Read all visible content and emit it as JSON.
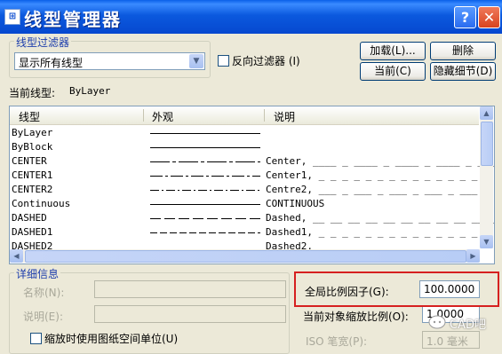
{
  "window": {
    "title": "线型管理器",
    "help_label": "?",
    "close_label": "✕"
  },
  "filter": {
    "group_label": "线型过滤器",
    "selected": "显示所有线型",
    "invert_label": "反向过滤器 (I)",
    "invert_checked": false
  },
  "buttons": {
    "load": "加载(L)...",
    "delete": "删除",
    "current": "当前(C)",
    "hide_details": "隐藏细节(D)"
  },
  "current_linetype": {
    "label": "当前线型:",
    "value": "ByLayer"
  },
  "table": {
    "headers": [
      "线型",
      "外观",
      "说明"
    ],
    "rows": [
      {
        "name": "ByLayer",
        "appearance": "solid",
        "description": ""
      },
      {
        "name": "ByBlock",
        "appearance": "solid",
        "description": ""
      },
      {
        "name": "CENTER",
        "appearance": "center",
        "description": "Center, ____ _ ____ _ ____ _ ____ _ ___"
      },
      {
        "name": "CENTER1",
        "appearance": "center",
        "description": "Center1, _ _ _ _ _ _ _ _ _ _ _ _ _ _ _ _"
      },
      {
        "name": "CENTER2",
        "appearance": "center2",
        "description": "Centre2, ___ _ ___ _ ___ _ ___ _ ___ _"
      },
      {
        "name": "Continuous",
        "appearance": "solid",
        "description": "CONTINUOUS"
      },
      {
        "name": "DASHED",
        "appearance": "dashed",
        "description": "Dashed, __ __ __ __ __ __ __ __ __ __ __"
      },
      {
        "name": "DASHED1",
        "appearance": "dashed",
        "description": "Dashed1, _ _ _ _ _ _ _ _ _ _ _ _ _ _ _ _"
      },
      {
        "name": "DASHED2",
        "appearance": "dashed",
        "description": "Dashed2, _ _ _ _ _ _ _ _ _ _ _ _ _ _ _ _"
      }
    ]
  },
  "details": {
    "group_label": "详细信息",
    "name_label": "名称(N):",
    "desc_label": "说明(E):",
    "paper_space_label": "缩放时使用图纸空间单位(U)",
    "paper_space_checked": false,
    "global_scale_label": "全局比例因子(G):",
    "global_scale_value": "100.0000",
    "object_scale_label": "当前对象缩放比例(O):",
    "object_scale_value": "1.0000",
    "iso_pen_label": "ISO 笔宽(P):",
    "iso_pen_value": "1.0 毫米"
  },
  "watermark": "CAD吧",
  "colors": {
    "title_blue": "#0648CF",
    "highlight_red": "#D62020"
  }
}
